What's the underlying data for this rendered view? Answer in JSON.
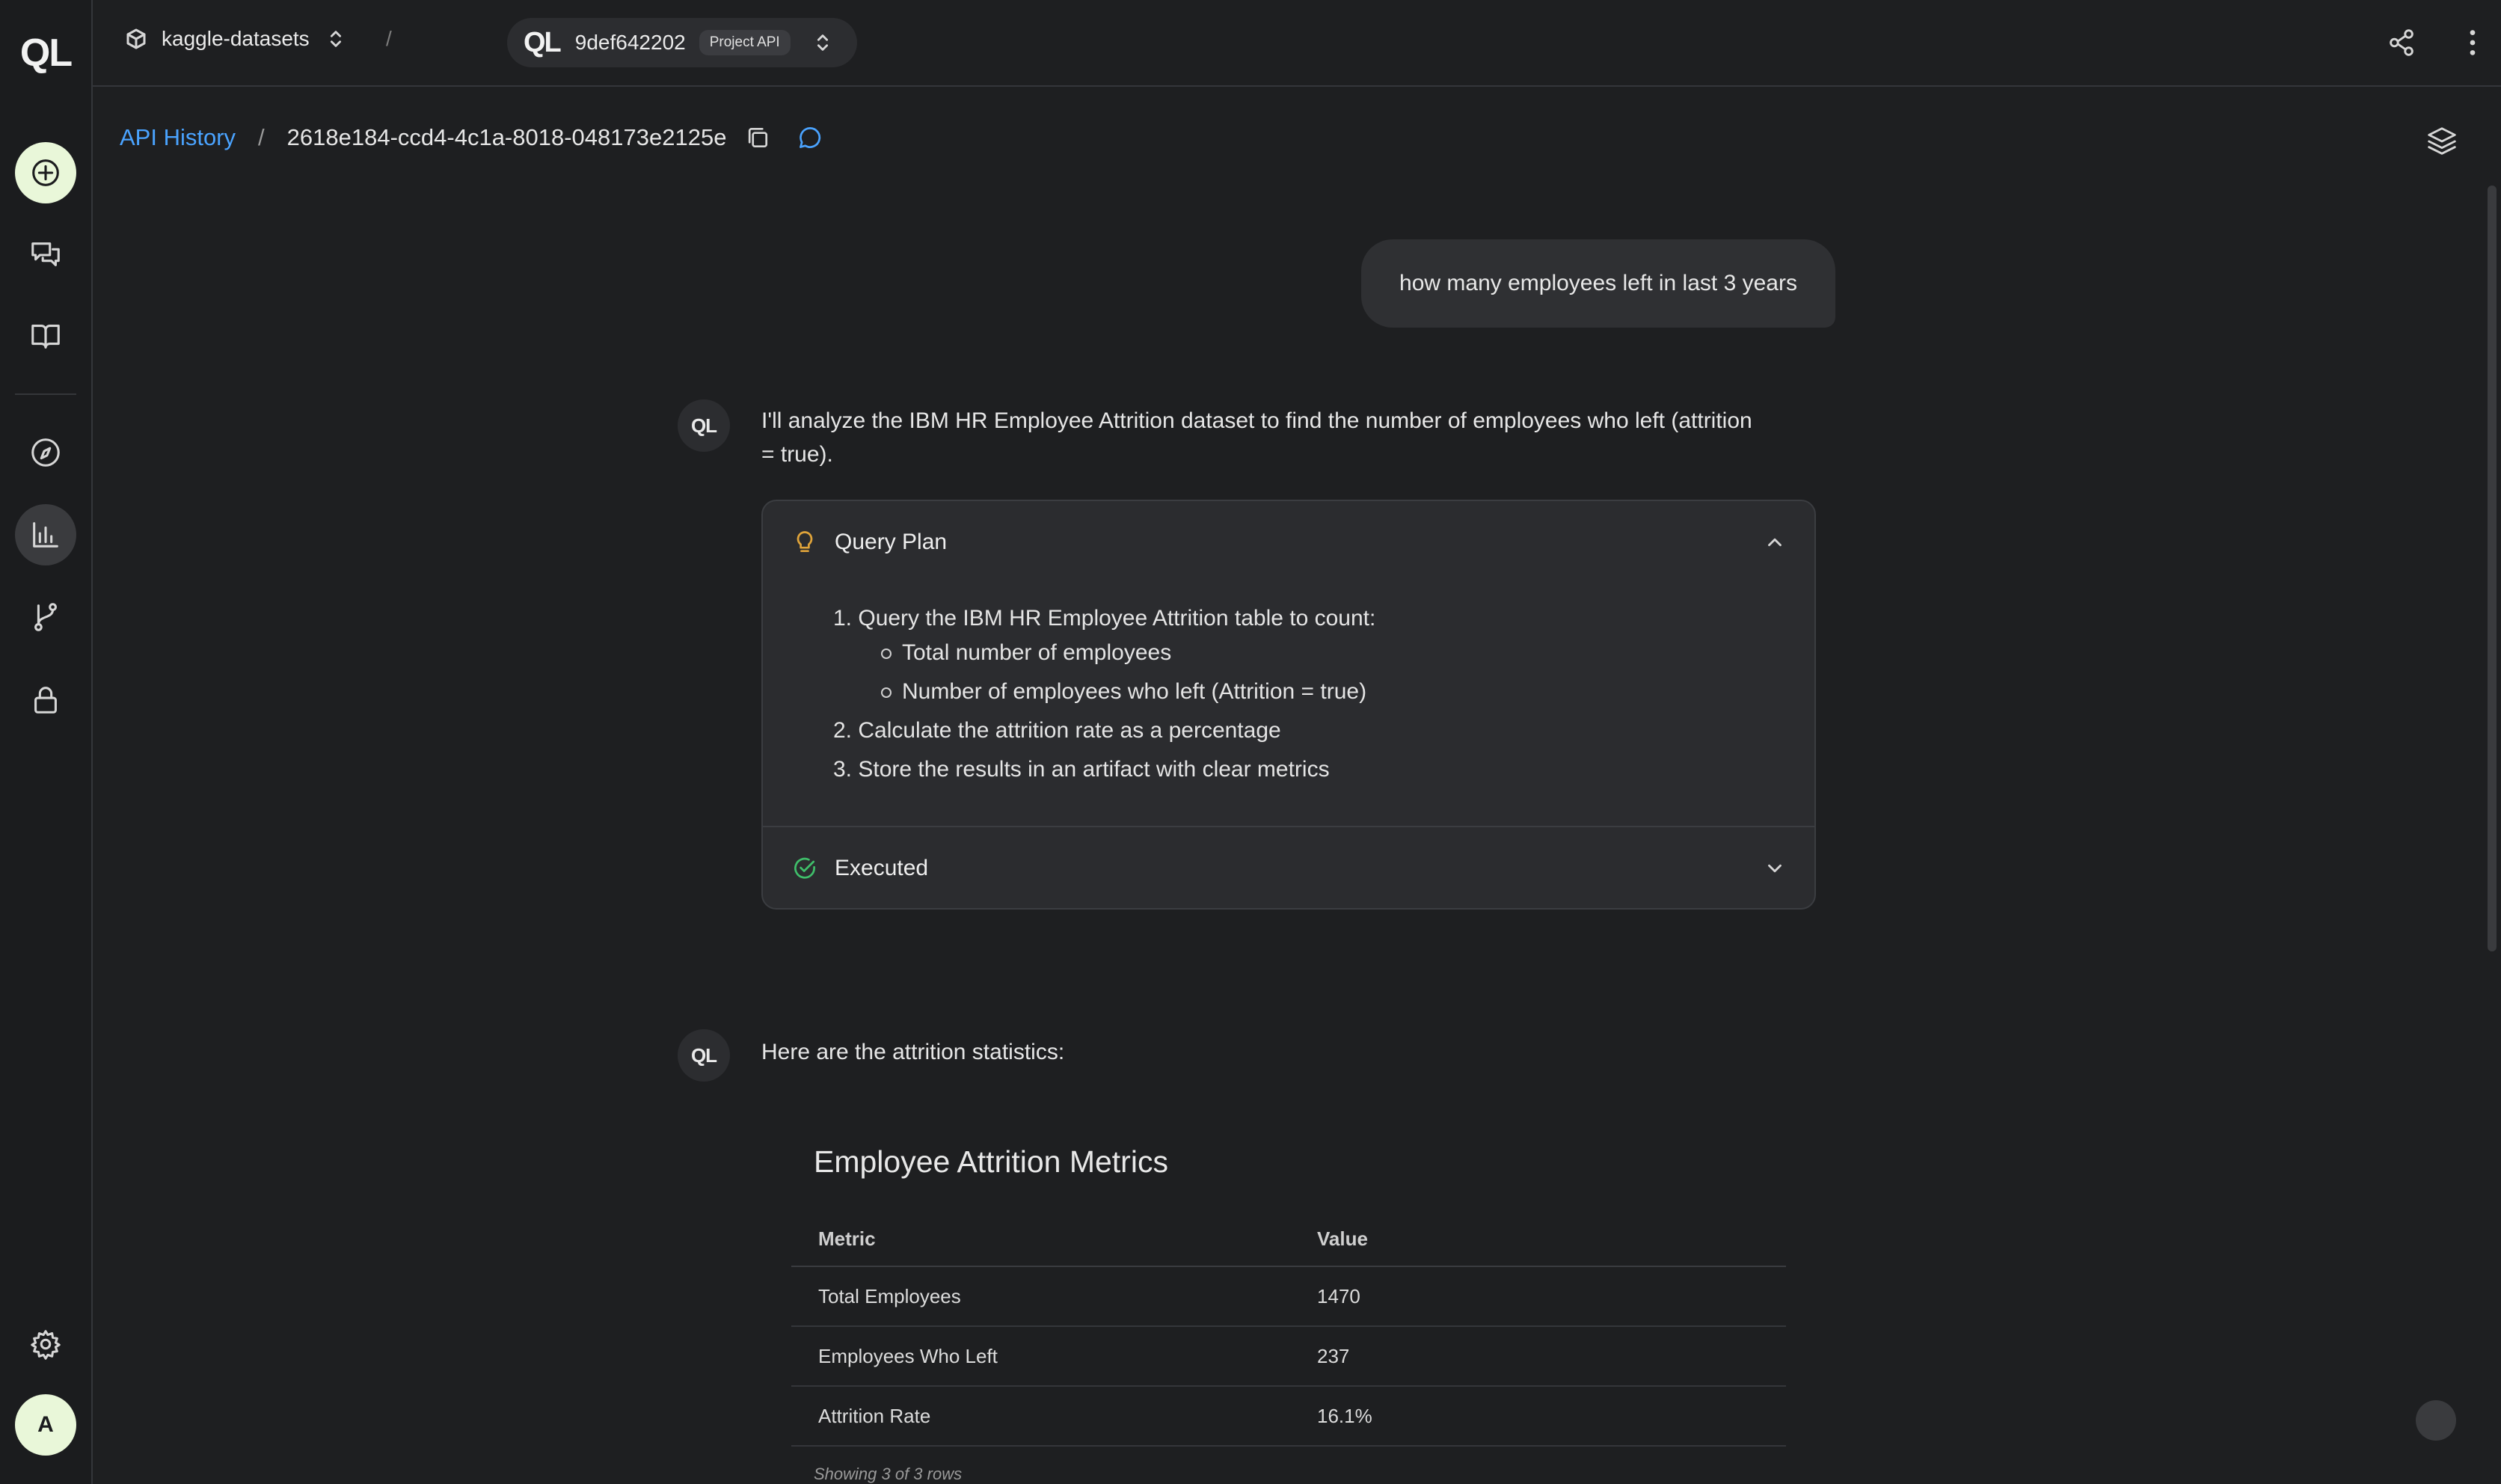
{
  "app": {
    "logo": "QL",
    "user_initial": "A"
  },
  "topbar": {
    "workspace": "kaggle-datasets",
    "separator": "/",
    "project_id": "9def642202",
    "project_badge": "Project API"
  },
  "breadcrumb": {
    "root": "API History",
    "separator": "/",
    "session_id": "2618e184-ccd4-4c1a-8018-048173e2125e"
  },
  "chat": {
    "user_message": "how many employees left in last 3 years",
    "assistant_intro_line1": "I'll analyze the IBM HR Employee Attrition dataset to find the number of employees who left (attrition",
    "assistant_intro_line2": "= true).",
    "plan": {
      "title": "Query Plan",
      "step1": "1. Query the IBM HR Employee Attrition table to count:",
      "step1_sub1": "Total number of employees",
      "step1_sub2": "Number of employees who left (Attrition = true)",
      "step2": "2. Calculate the attrition rate as a percentage",
      "step3": "3. Store the results in an artifact with clear metrics"
    },
    "executed_label": "Executed",
    "assistant_result_intro": "Here are the attrition statistics:",
    "artifact": {
      "title": "Employee Attrition Metrics",
      "columns": [
        "Metric",
        "Value"
      ],
      "rows": [
        [
          "Total Employees",
          "1470"
        ],
        [
          "Employees Who Left",
          "237"
        ],
        [
          "Attrition Rate",
          "16.1%"
        ]
      ],
      "footer": "Showing 3 of 3 rows"
    }
  },
  "colors": {
    "background": "#1e1f21",
    "accent_link": "#4aa3ff",
    "new_button": "#e9f7d9",
    "plan_icon": "#e0a43a",
    "executed_icon": "#3fbf6a"
  }
}
